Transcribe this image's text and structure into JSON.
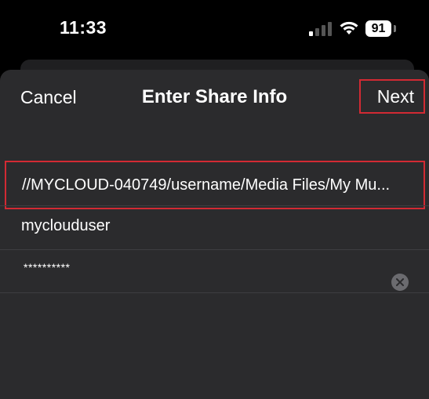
{
  "status_bar": {
    "time": "11:33",
    "battery_level": "91"
  },
  "nav": {
    "cancel_label": "Cancel",
    "title": "Enter Share Info",
    "next_label": "Next"
  },
  "fields": {
    "share_path": "//MYCLOUD-040749/username/Media Files/My Mu...",
    "username": "myclouduser",
    "password": "**********"
  },
  "icons": {
    "signal": "cellular-signal-icon",
    "wifi": "wifi-icon",
    "battery": "battery-icon",
    "clear": "clear-icon"
  },
  "colors": {
    "highlight": "#d22a33",
    "sheet_background": "#2b2b2d"
  }
}
